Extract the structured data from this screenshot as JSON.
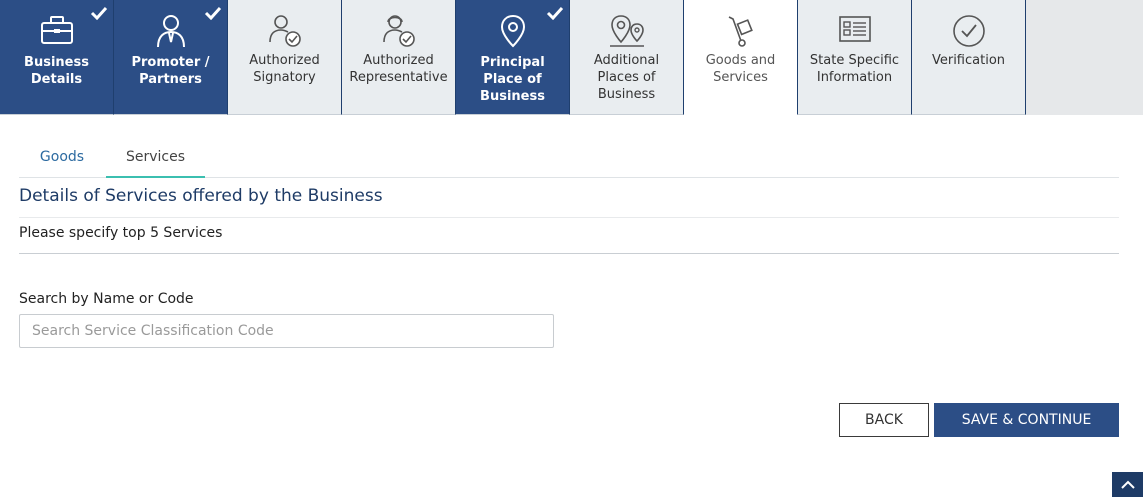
{
  "steps": [
    {
      "label": "Business Details",
      "icon": "briefcase-icon",
      "state": "done"
    },
    {
      "label": "Promoter / Partners",
      "icon": "person-tie-icon",
      "state": "done"
    },
    {
      "label": "Authorized Signatory",
      "icon": "person-check-icon",
      "state": "pending"
    },
    {
      "label": "Authorized Representative",
      "icon": "person-headset-check-icon",
      "state": "pending"
    },
    {
      "label": "Principal Place of Business",
      "icon": "location-pin-icon",
      "state": "done"
    },
    {
      "label": "Additional Places of Business",
      "icon": "multiple-pins-icon",
      "state": "pending"
    },
    {
      "label": "Goods and Services",
      "icon": "hand-truck-icon",
      "state": "active"
    },
    {
      "label": "State Specific Information",
      "icon": "id-card-icon",
      "state": "pending"
    },
    {
      "label": "Verification",
      "icon": "check-circle-icon",
      "state": "pending"
    }
  ],
  "subtabs": {
    "goods": "Goods",
    "services": "Services",
    "active": "Services"
  },
  "section": {
    "title": "Details of Services offered by the Business",
    "hint": "Please specify top 5 Services"
  },
  "search": {
    "label": "Search by Name or Code",
    "value": "",
    "placeholder": "Search Service Classification Code"
  },
  "buttons": {
    "back": "BACK",
    "save": "SAVE & CONTINUE"
  },
  "colors": {
    "primary": "#2c4e86",
    "pending_tab": "#e9edf0",
    "active_tab_underline": "#3bbfb0",
    "title": "#1e3b66"
  }
}
